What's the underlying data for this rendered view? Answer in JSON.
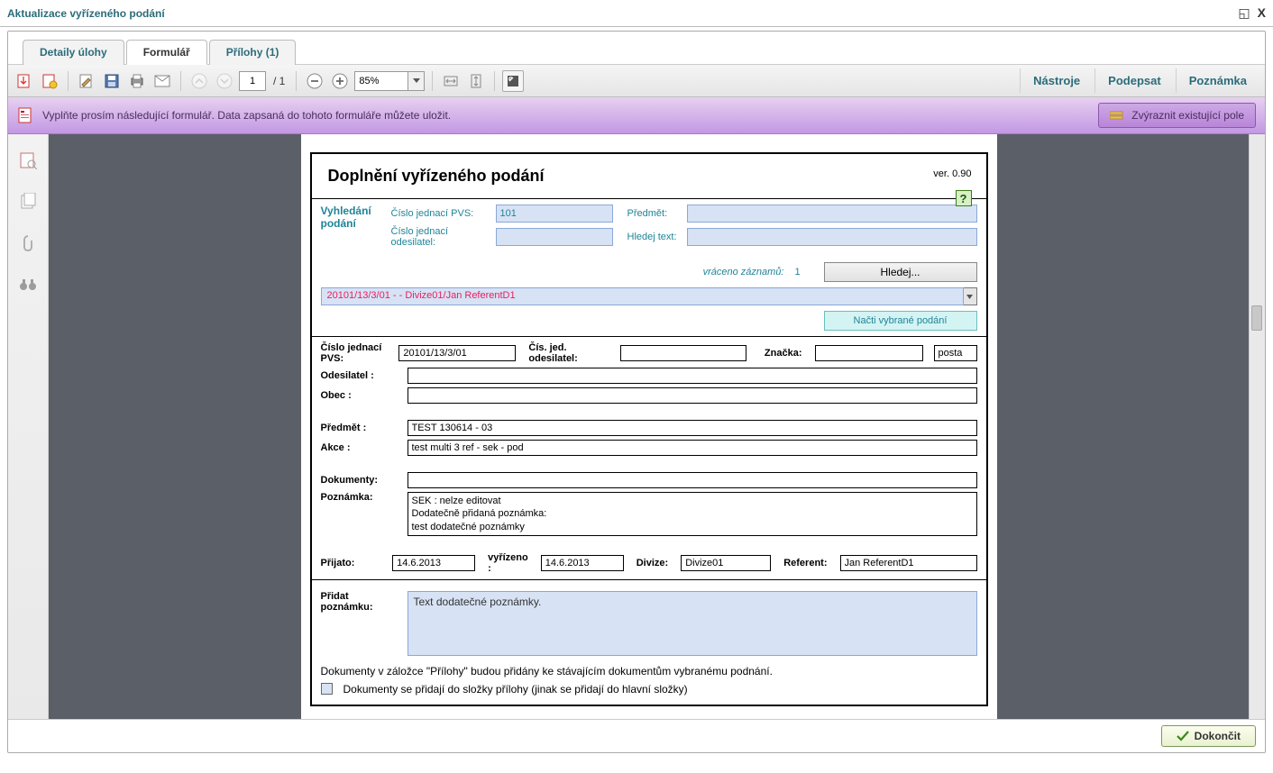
{
  "window": {
    "title": "Aktualizace vyřízeného podání"
  },
  "tabs": {
    "detail": "Detaily úlohy",
    "form": "Formulář",
    "attachments": "Přílohy (1)"
  },
  "toolbar": {
    "page_current": "1",
    "page_total": "/ 1",
    "zoom": "85%",
    "nastroje": "Nástroje",
    "podepsat": "Podepsat",
    "poznamka": "Poznámka"
  },
  "infobar": {
    "text": "Vyplňte prosím následující formulář. Data zapsaná do tohoto formuláře můžete uložit.",
    "highlight_btn": "Zvýraznit existující pole"
  },
  "form": {
    "title": "Doplnění vyřízeného podání",
    "version": "ver. 0.90",
    "help": "?",
    "search": {
      "heading1": "Vyhledání",
      "heading2": "podání",
      "cj_pvs_label": "Číslo jednací PVS:",
      "cj_pvs_value": "101",
      "cj_odesilatel_label": "Číslo jednací odesilatel:",
      "cj_odesilatel_value": "",
      "predmet_label": "Předmět:",
      "predmet_value": "",
      "hledej_text_label": "Hledej text:",
      "hledej_text_value": "",
      "records_label": "vráceno záznamů:",
      "records_count": "1",
      "search_btn": "Hledej...",
      "result": "20101/13/3/01 -    - Divize01/Jan ReferentD1",
      "load_btn": "Načti vybrané podání"
    },
    "detail": {
      "cj_pvs_label": "Číslo jednací PVS:",
      "cj_pvs": "20101/13/3/01",
      "cj_odesilatel_label": "Čís. jed. odesilatel:",
      "cj_odesilatel": "",
      "znacka_label": "Značka:",
      "znacka_short": "",
      "znacka_val": "posta",
      "odesilatel_label": "Odesilatel :",
      "odesilatel": "",
      "obec_label": "Obec :",
      "obec": "",
      "predmet_label": "Předmět :",
      "predmet": "TEST 130614 - 03",
      "akce_label": "Akce :",
      "akce": "test multi 3 ref - sek - pod",
      "dokumenty_label": "Dokumenty:",
      "dokumenty": "",
      "poznamka_label": "Poznámka:",
      "poznamka_l1": "SEK : nelze editovat",
      "poznamka_l2": "Dodatečně přidaná poznámka:",
      "poznamka_l3": "test dodatečné poznámky",
      "prijato_label": "Přijato:",
      "prijato": "14.6.2013",
      "vyrizeno_label": "vyřízeno :",
      "vyrizeno": "14.6.2013",
      "divize_label": "Divize:",
      "divize": "Divize01",
      "referent_label": "Referent:",
      "referent": "Jan ReferentD1"
    },
    "add_note": {
      "label1": "Přidat",
      "label2": "poznámku:",
      "value": "Text dodatečné poznámky."
    },
    "doc_info": "Dokumenty v záložce \"Přílohy\" budou přidány ke stávajícím dokumentům vybranému podnání.",
    "doc_checkbox": "Dokumenty  se přidají do složky přílohy (jinak se přidají do hlavní složky)"
  },
  "footer": {
    "finish": "Dokončit"
  }
}
